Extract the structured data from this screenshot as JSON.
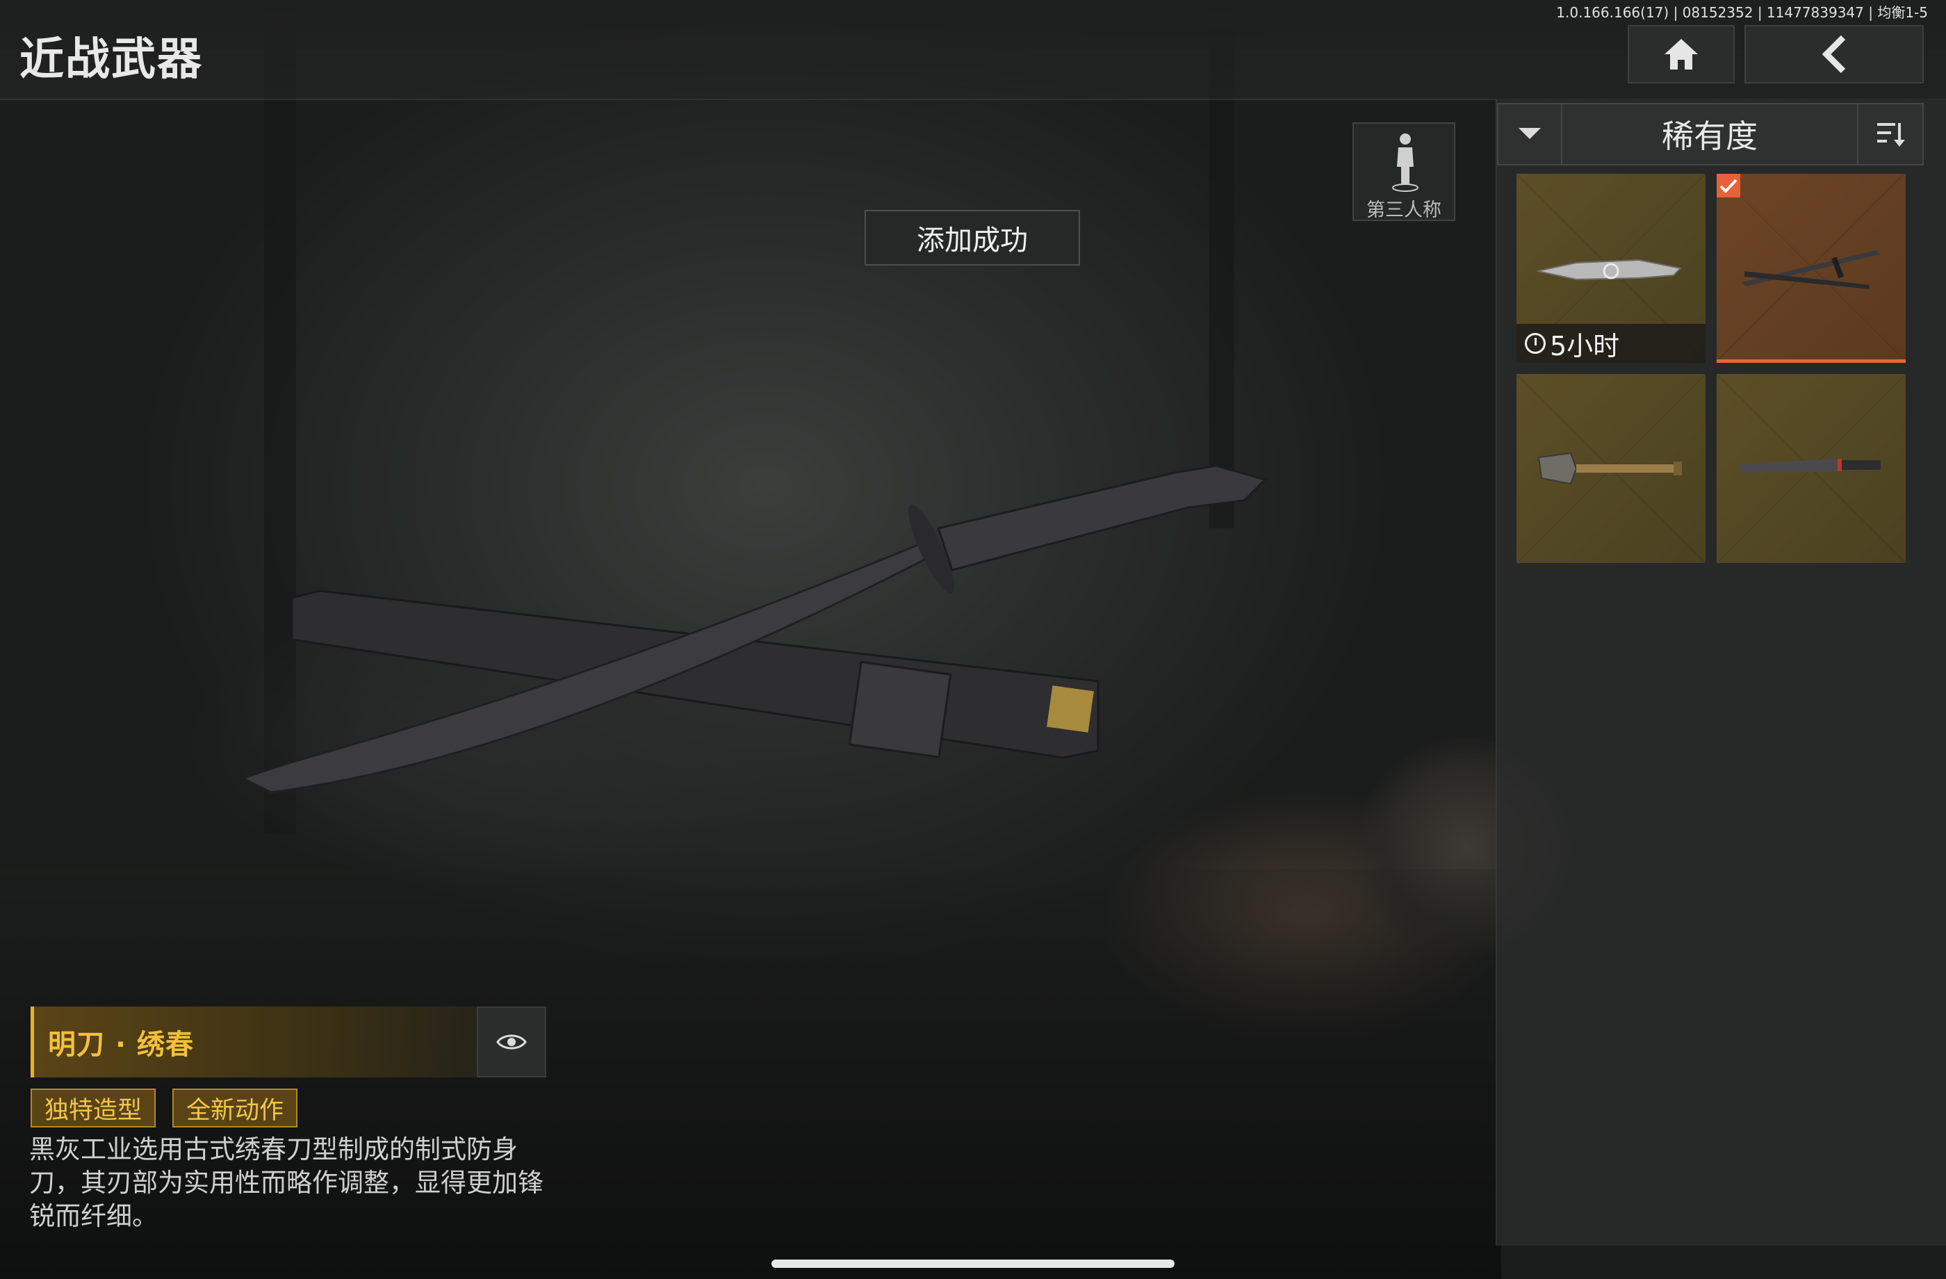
{
  "header": {
    "title": "近战武器",
    "version": "1.0.166.166(17) | 08152352 | 11477839347 | 均衡1-5",
    "home_icon": "home-icon",
    "back_icon": "chevron-left-icon"
  },
  "view_toggle": {
    "label": "第三人称",
    "icon": "third-person-figure-icon"
  },
  "toast": {
    "text": "添加成功"
  },
  "sort": {
    "label": "稀有度",
    "dropdown_icon": "chevron-down-icon",
    "order_icon": "sort-order-icon"
  },
  "items": [
    {
      "kind": "ornate-knife",
      "timer": "5小时",
      "selected": false
    },
    {
      "kind": "katana",
      "timer": "",
      "selected": true
    },
    {
      "kind": "shovel",
      "timer": "",
      "selected": false
    },
    {
      "kind": "machete",
      "timer": "",
      "selected": false
    }
  ],
  "weapon": {
    "name": "明刀 · 绣春",
    "tags": [
      "独特造型",
      "全新动作"
    ],
    "description": "黑灰工业选用古式绣春刀型制成的制式防身刀，其刃部为实用性而略作调整，显得更加锋锐而纤细。",
    "preview_icon": "eye-icon"
  },
  "colors": {
    "accent": "#e8b325",
    "selected": "#e0683a",
    "card": "#5c4f27"
  }
}
